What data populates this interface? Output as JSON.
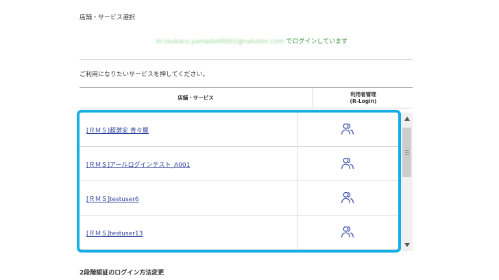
{
  "page": {
    "title": "店舗・サービス選択",
    "login_email": "kr-tsubaru.yamada00001@rakuten.com",
    "login_suffix": "でログインしています",
    "instruction": "ご利用になりたいサービスを押してください。"
  },
  "table": {
    "header_store": "店舗・サービス",
    "header_user_line1": "利用者管理",
    "header_user_line2": "(R-Login)",
    "rows": [
      {
        "label": "[ＲＭＳ]超激安 青々屋"
      },
      {
        "label": "[ＲＭＳ]アールログインテスト_A001"
      },
      {
        "label": "[ＲＭＳ]testuser6"
      },
      {
        "label": "[ＲＭＳ]testuser13"
      }
    ]
  },
  "icons": {
    "user_management": "users-icon",
    "scroll_up": "triangle-up-icon",
    "scroll_down": "triangle-down-icon"
  },
  "colors": {
    "link": "#2b3f9b",
    "login_text": "#2f8f2f",
    "highlight_border": "#14aee6",
    "icon": "#3a4fa8"
  },
  "footer": {
    "section_heading": "2段階認証のログイン方法変更"
  }
}
